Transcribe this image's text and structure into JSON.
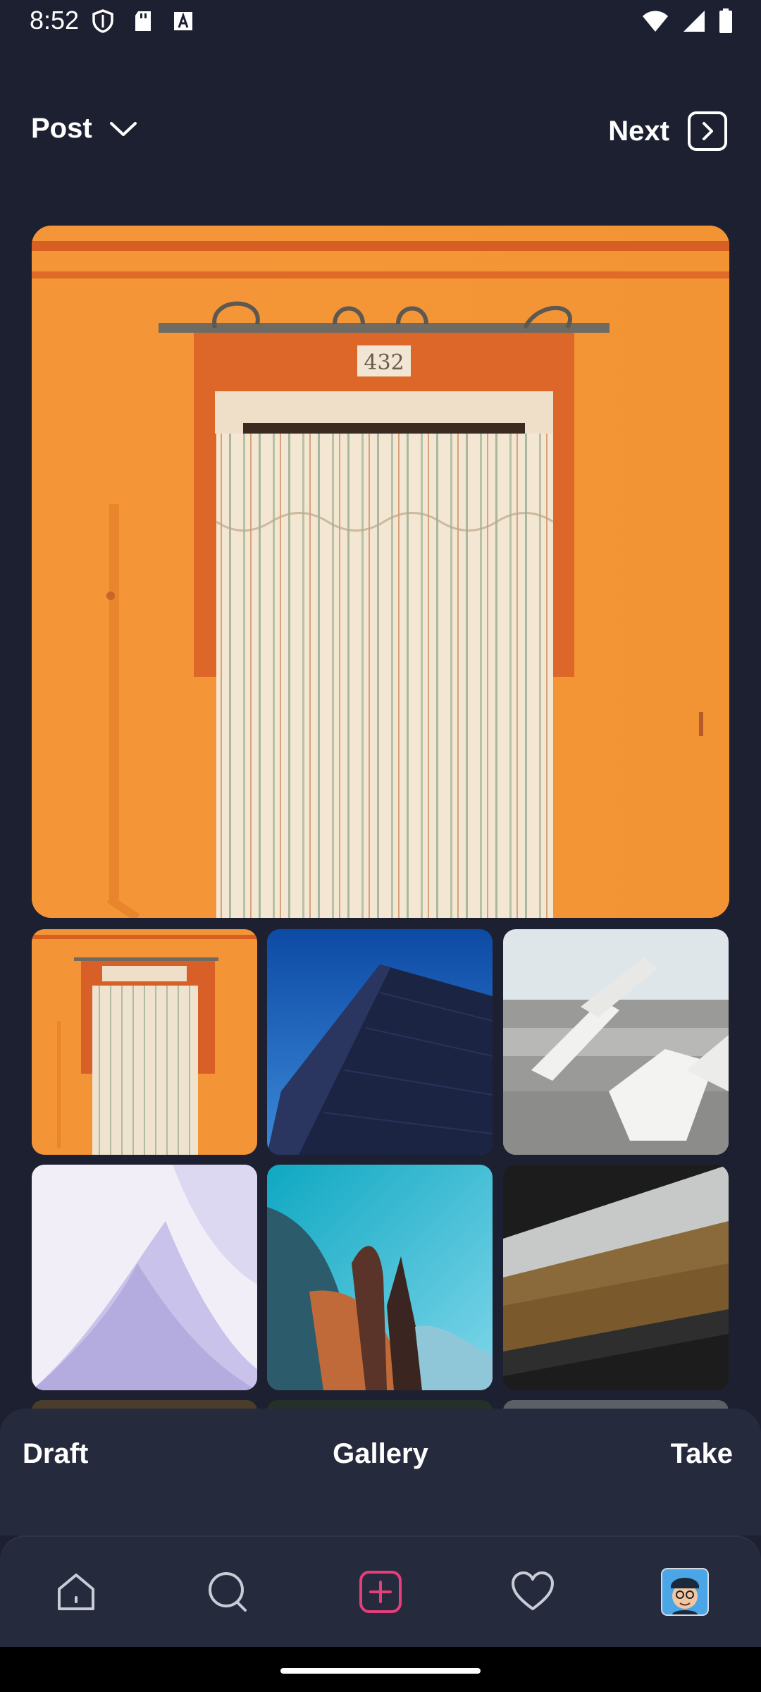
{
  "status_bar": {
    "time": "8:52",
    "left_icons": [
      "shield-icon",
      "sd-card-icon",
      "font-icon"
    ],
    "right_icons": [
      "wifi-icon",
      "signal-icon",
      "battery-icon"
    ]
  },
  "header": {
    "post_label": "Post",
    "next_label": "Next"
  },
  "preview": {
    "house_number": "432"
  },
  "gallery": {
    "thumbnails": [
      {
        "name": "orange-door-photo"
      },
      {
        "name": "blue-building-photo"
      },
      {
        "name": "white-concrete-photo"
      },
      {
        "name": "lavender-curves-photo"
      },
      {
        "name": "teal-sky-architecture-photo"
      },
      {
        "name": "autumn-forest-photo"
      }
    ]
  },
  "modes": {
    "draft": "Draft",
    "gallery": "Gallery",
    "take": "Take"
  },
  "nav": {
    "items": [
      "home-icon",
      "search-icon",
      "create-icon",
      "heart-icon",
      "profile-avatar"
    ],
    "accent_color": "#e63e7a"
  }
}
